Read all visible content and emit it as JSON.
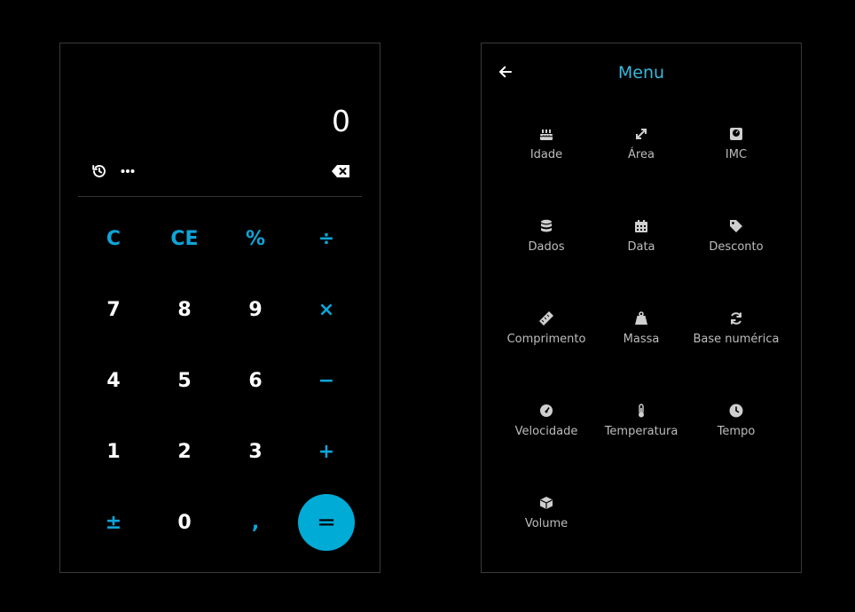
{
  "calculator": {
    "display": "0",
    "tools": {
      "history_icon": "history-icon",
      "more_icon": "more-icon",
      "backspace_icon": "backspace-icon"
    },
    "keys": [
      [
        "C",
        "CE",
        "%",
        "÷"
      ],
      [
        "7",
        "8",
        "9",
        "×"
      ],
      [
        "4",
        "5",
        "6",
        "−"
      ],
      [
        "1",
        "2",
        "3",
        "+"
      ],
      [
        "±",
        "0",
        ",",
        "="
      ]
    ],
    "accent_color": "#0ea5d9",
    "equals_color": "#00abd6"
  },
  "menu": {
    "title": "Menu",
    "items": [
      {
        "label": "Idade",
        "icon": "cake-icon"
      },
      {
        "label": "Área",
        "icon": "expand-icon"
      },
      {
        "label": "IMC",
        "icon": "scale-icon"
      },
      {
        "label": "Dados",
        "icon": "database-icon"
      },
      {
        "label": "Data",
        "icon": "calendar-icon"
      },
      {
        "label": "Desconto",
        "icon": "tag-icon"
      },
      {
        "label": "Comprimento",
        "icon": "ruler-icon"
      },
      {
        "label": "Massa",
        "icon": "weight-icon"
      },
      {
        "label": "Base numérica",
        "icon": "sync-icon"
      },
      {
        "label": "Velocidade",
        "icon": "gauge-icon"
      },
      {
        "label": "Temperatura",
        "icon": "thermometer-icon"
      },
      {
        "label": "Tempo",
        "icon": "clock-icon"
      },
      {
        "label": "Volume",
        "icon": "cube-icon"
      }
    ],
    "title_color": "#39b8dd"
  }
}
